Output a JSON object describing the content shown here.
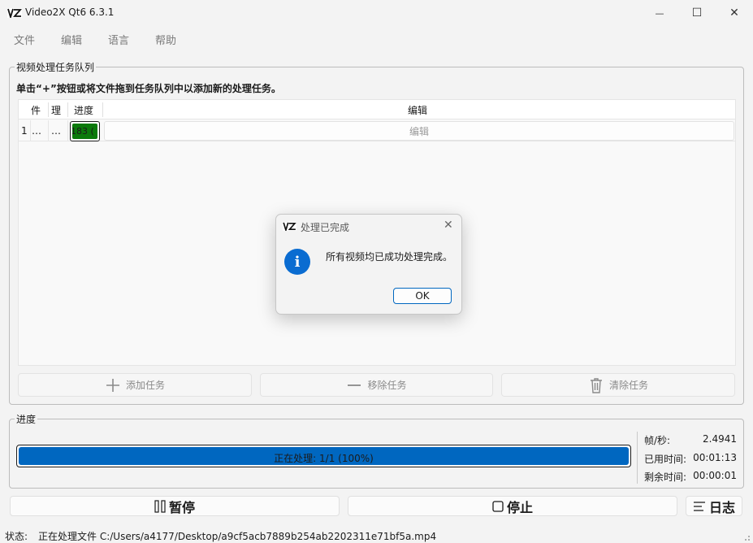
{
  "window": {
    "title": "Video2X Qt6 6.3.1",
    "controls": {
      "minimize": "—",
      "maximize": "☐",
      "close": "✕"
    }
  },
  "menu": [
    "文件",
    "编辑",
    "语言",
    "帮助"
  ],
  "queue": {
    "group_title": "视频处理任务队列",
    "hint": "单击“+”按钮或将文件拖到任务队列中以添加新的处理任务。",
    "headers": [
      "件",
      "理",
      "进度",
      "编辑"
    ],
    "rows": [
      {
        "index": "1",
        "file": "…",
        "proc": "…",
        "progress_text": "183 (",
        "progress": 1.0,
        "edit": "编辑"
      }
    ],
    "buttons": {
      "add": "添加任务",
      "remove": "移除任务",
      "clear": "清除任务"
    }
  },
  "progress": {
    "group_title": "进度",
    "bar_text": "正在处理: 1/1 (100%)",
    "value": 1.0,
    "stats": [
      {
        "label": "帧/秒:",
        "value": "2.4941"
      },
      {
        "label": "已用时间:",
        "value": "00:01:13"
      },
      {
        "label": "剩余时间:",
        "value": "00:00:01"
      }
    ]
  },
  "controls": {
    "pause": "暂停",
    "stop": "停止",
    "log": "日志"
  },
  "status": {
    "label": "状态:",
    "text": "正在处理文件 C:/Users/a4177/Desktop/a9cf5acb7889b254ab2202311e71bf5a.mp4"
  },
  "dialog": {
    "title": "处理已完成",
    "message": "所有视频均已成功处理完成。",
    "ok": "OK",
    "icon": "information-icon"
  },
  "colors": {
    "accent": "#0067c0",
    "row_progress": "#0b7a0b"
  }
}
